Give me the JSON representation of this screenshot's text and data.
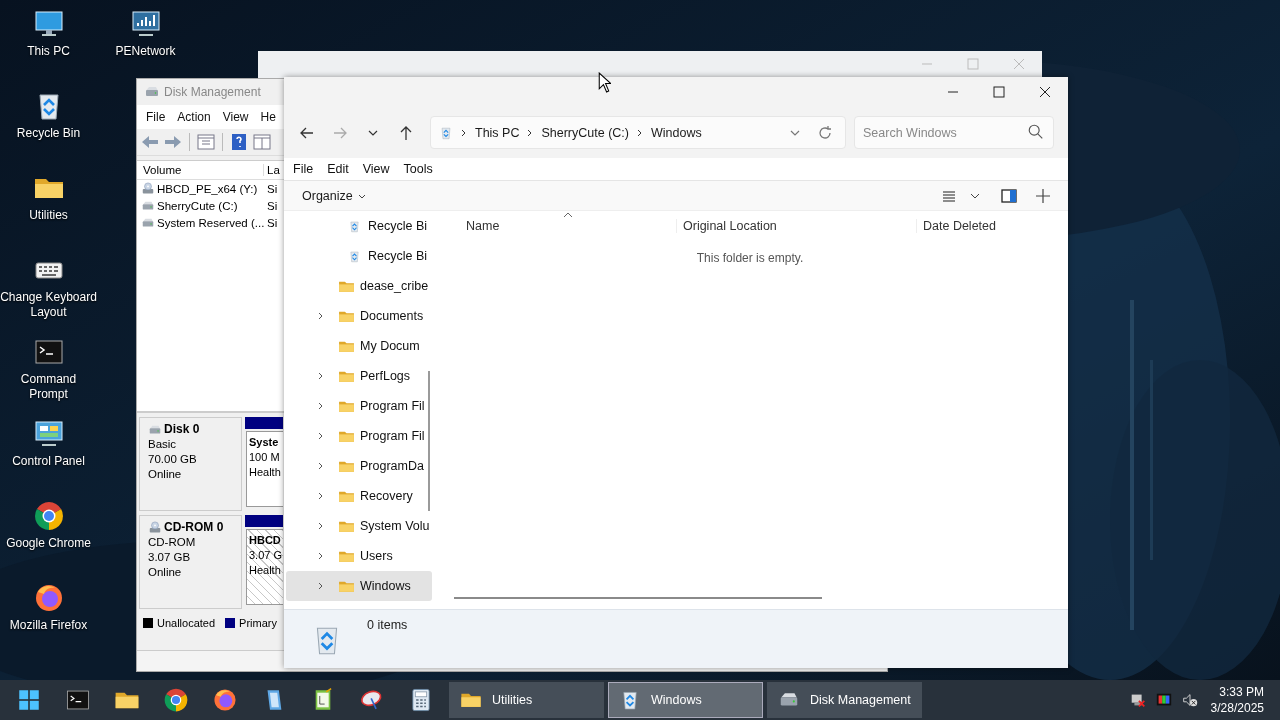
{
  "desktop_icons": [
    {
      "label": "This PC",
      "kind": "pc"
    },
    {
      "label": "Recycle Bin",
      "kind": "recycle"
    },
    {
      "label": "Utilities",
      "kind": "folder"
    },
    {
      "label": "Change Keyboard Layout",
      "kind": "keyboard"
    },
    {
      "label": "Command Prompt",
      "kind": "cmd"
    },
    {
      "label": "Control Panel",
      "kind": "control"
    },
    {
      "label": "Google Chrome",
      "kind": "chrome"
    },
    {
      "label": "Mozilla Firefox",
      "kind": "firefox"
    },
    {
      "label": "PENetwork",
      "kind": "network"
    }
  ],
  "disk_management": {
    "title": "Disk Management",
    "menu": [
      "File",
      "Action",
      "View",
      "He"
    ],
    "columns": [
      "Volume",
      "La"
    ],
    "volumes": [
      {
        "name": "HBCD_PE_x64 (Y:)",
        "layout": "Si",
        "kind": "cd"
      },
      {
        "name": "SherryCute (C:)",
        "layout": "Si",
        "kind": "disk"
      },
      {
        "name": "System Reserved (...",
        "layout": "Si",
        "kind": "disk"
      }
    ],
    "disks": [
      {
        "name": "Disk 0",
        "kind": "disk",
        "type": "Basic",
        "size": "70.00 GB",
        "status": "Online",
        "partition": {
          "name": "Syste",
          "size": "100 M",
          "health": "Health",
          "hatched": false
        }
      },
      {
        "name": "CD-ROM 0",
        "kind": "cd",
        "type": "CD-ROM",
        "size": "3.07 GB",
        "status": "Online",
        "partition": {
          "name": "HBCD",
          "size": "3.07 G",
          "health": "Health",
          "hatched": true
        }
      }
    ],
    "legend": [
      {
        "label": "Unallocated",
        "color": "#000000"
      },
      {
        "label": "Primary",
        "color": "#000080"
      }
    ]
  },
  "explorer": {
    "breadcrumb": [
      "This PC",
      "SherryCute (C:)",
      "Windows"
    ],
    "search": {
      "placeholder": "Search Windows"
    },
    "menu": [
      "File",
      "Edit",
      "View",
      "Tools"
    ],
    "organize": "Organize",
    "nav": [
      {
        "label": "Recycle Bi",
        "kind": "recycle",
        "expandable": false,
        "selected": false
      },
      {
        "label": "Recycle Bi",
        "kind": "recycle",
        "expandable": false,
        "selected": false
      },
      {
        "label": "dease_cribe",
        "kind": "folder",
        "expandable": false,
        "selected": false
      },
      {
        "label": "Documents",
        "kind": "folder",
        "expandable": true,
        "selected": false
      },
      {
        "label": "My Docum",
        "kind": "folder",
        "expandable": false,
        "selected": false
      },
      {
        "label": "PerfLogs",
        "kind": "folder",
        "expandable": true,
        "selected": false
      },
      {
        "label": "Program Fil",
        "kind": "folder",
        "expandable": true,
        "selected": false
      },
      {
        "label": "Program Fil",
        "kind": "folder",
        "expandable": true,
        "selected": false
      },
      {
        "label": "ProgramDa",
        "kind": "folder",
        "expandable": true,
        "selected": false
      },
      {
        "label": "Recovery",
        "kind": "folder",
        "expandable": true,
        "selected": false
      },
      {
        "label": "System Volu",
        "kind": "folder",
        "expandable": true,
        "selected": false
      },
      {
        "label": "Users",
        "kind": "folder",
        "expandable": true,
        "selected": false
      },
      {
        "label": "Windows",
        "kind": "folder",
        "expandable": true,
        "selected": true
      }
    ],
    "columns": [
      "Name",
      "Original Location",
      "Date Deleted"
    ],
    "empty_message": "This folder is empty.",
    "status": "0 items"
  },
  "taskbar": {
    "pinned": [
      {
        "kind": "start"
      },
      {
        "kind": "cmd"
      },
      {
        "kind": "folder"
      },
      {
        "kind": "chrome"
      },
      {
        "kind": "firefox"
      },
      {
        "kind": "notepad"
      },
      {
        "kind": "doc"
      },
      {
        "kind": "dish"
      },
      {
        "kind": "calc"
      }
    ],
    "tasks": [
      {
        "label": "Utilities",
        "kind": "folder",
        "selected": false
      },
      {
        "label": "Windows",
        "kind": "recycle",
        "selected": true
      },
      {
        "label": "Disk Management",
        "kind": "disk",
        "selected": false
      }
    ],
    "clock": {
      "time": "3:33 PM",
      "date": "3/28/2025"
    }
  }
}
